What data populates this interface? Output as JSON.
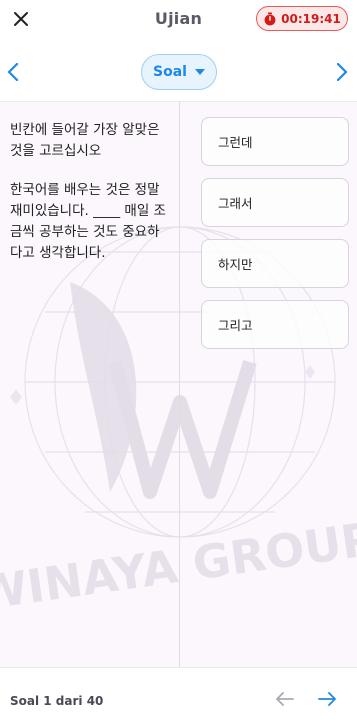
{
  "header": {
    "title": "Ujian",
    "timer": "00:19:41",
    "close_icon": "close-icon",
    "timer_icon": "stopwatch-icon"
  },
  "nav": {
    "soal_label": "Soal",
    "prev_icon": "chevron-left-icon",
    "next_icon": "chevron-right-icon"
  },
  "question": {
    "instruction": "빈칸에 들어갈 가장 알맞은 것을 고르십시오",
    "text": "한국어를 배우는 것은 정말 재미있습니다. ____ 매일 조금씩 공부하는 것도 중요하다고 생각합니다."
  },
  "options": [
    "그런데",
    "그래서",
    "하지만",
    "그리고"
  ],
  "footer": {
    "counter": "Soal 1 dari 40",
    "prev_icon": "arrow-left-icon",
    "next_icon": "arrow-right-icon"
  },
  "colors": {
    "accent": "#1e88e5",
    "timer_red": "#d11c1c",
    "timer_bg": "#fde8e8",
    "pane_bg": "#fbf7fc"
  },
  "watermark": {
    "text": "WINAYA GROUP",
    "letter": "W"
  }
}
